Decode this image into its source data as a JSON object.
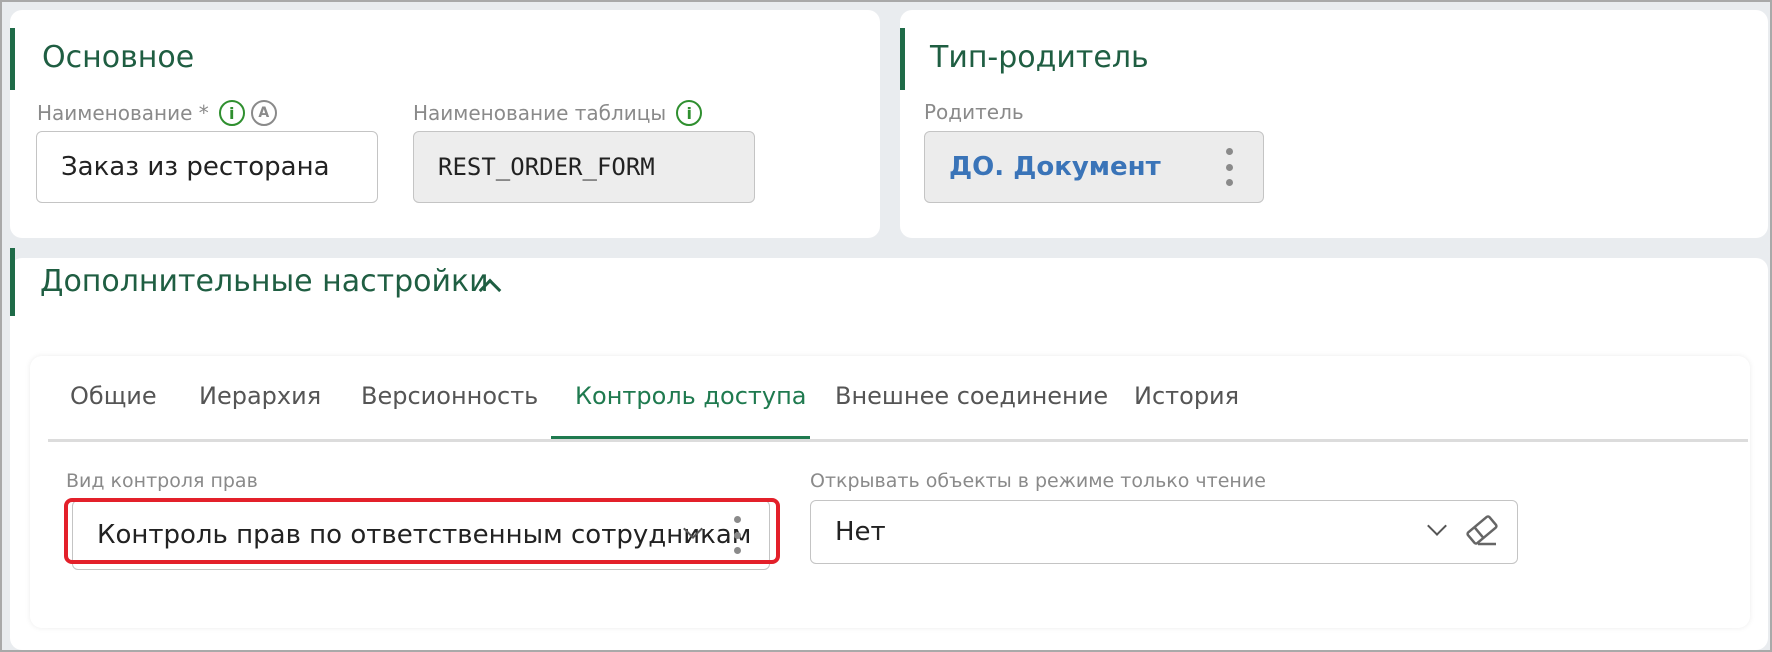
{
  "main_section": {
    "title": "Основное",
    "name_label": "Наименование *",
    "name_value": "Заказ из ресторана",
    "table_label": "Наименование таблицы",
    "table_value": "REST_ORDER_FORM",
    "info_icon_glyph": "i",
    "auto_icon_glyph": "A"
  },
  "parent_section": {
    "title": "Тип-родитель",
    "parent_label": "Родитель",
    "parent_value": "ДО. Документ"
  },
  "extra_section": {
    "title": "Дополнительные настройки",
    "tabs": [
      {
        "label": "Общие"
      },
      {
        "label": "Иерархия"
      },
      {
        "label": "Версионность"
      },
      {
        "label": "Контроль доступа"
      },
      {
        "label": "Внешнее соединение"
      },
      {
        "label": "История"
      }
    ],
    "active_tab": "Контроль доступа",
    "access_control_label": "Вид контроля прав",
    "access_control_value": "Контроль прав по ответственным сотрудникам",
    "readonly_label": "Открывать объекты в режиме только чтение",
    "readonly_value": "Нет"
  },
  "colors": {
    "accent": "#1f7a4f",
    "section_bar": "#1f6b48",
    "link": "#3a74b8",
    "highlight": "#e3202a"
  },
  "icons": {
    "info": "info-icon",
    "auto": "auto-fill-icon",
    "kebab": "kebab-menu-icon",
    "chevron_up": "chevron-up-icon",
    "chevron_down": "chevron-down-icon",
    "eraser": "eraser-icon"
  }
}
